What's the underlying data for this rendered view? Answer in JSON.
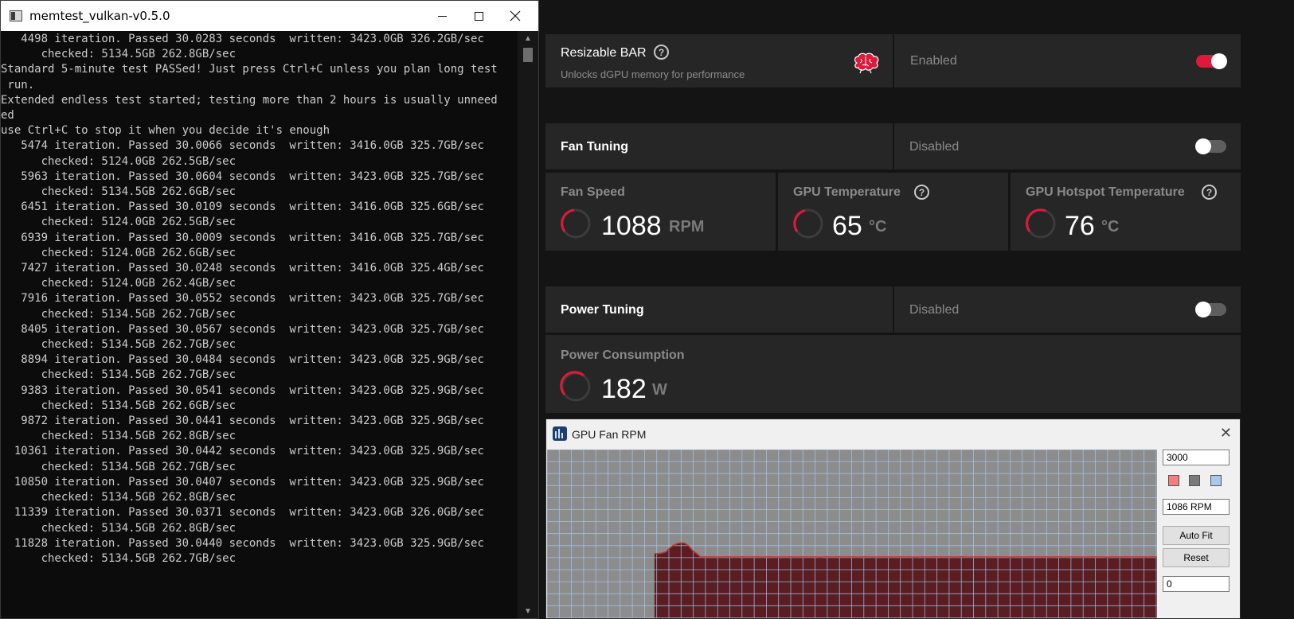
{
  "console": {
    "title": "memtest_vulkan-v0.5.0",
    "lines": [
      "   4498 iteration. Passed 30.0283 seconds  written: 3423.0GB 326.2GB/sec",
      "      checked: 5134.5GB 262.8GB/sec",
      "Standard 5-minute test PASSed! Just press Ctrl+C unless you plan long test",
      " run.",
      "Extended endless test started; testing more than 2 hours is usually unneed",
      "ed",
      "use Ctrl+C to stop it when you decide it's enough",
      "   5474 iteration. Passed 30.0066 seconds  written: 3416.0GB 325.7GB/sec",
      "      checked: 5124.0GB 262.5GB/sec",
      "   5963 iteration. Passed 30.0604 seconds  written: 3423.0GB 325.7GB/sec",
      "      checked: 5134.5GB 262.6GB/sec",
      "   6451 iteration. Passed 30.0109 seconds  written: 3416.0GB 325.6GB/sec",
      "      checked: 5124.0GB 262.5GB/sec",
      "   6939 iteration. Passed 30.0009 seconds  written: 3416.0GB 325.7GB/sec",
      "      checked: 5124.0GB 262.6GB/sec",
      "   7427 iteration. Passed 30.0248 seconds  written: 3416.0GB 325.4GB/sec",
      "      checked: 5124.0GB 262.4GB/sec",
      "   7916 iteration. Passed 30.0552 seconds  written: 3423.0GB 325.7GB/sec",
      "      checked: 5134.5GB 262.7GB/sec",
      "   8405 iteration. Passed 30.0567 seconds  written: 3423.0GB 325.7GB/sec",
      "      checked: 5134.5GB 262.7GB/sec",
      "   8894 iteration. Passed 30.0484 seconds  written: 3423.0GB 325.9GB/sec",
      "      checked: 5134.5GB 262.7GB/sec",
      "   9383 iteration. Passed 30.0541 seconds  written: 3423.0GB 325.9GB/sec",
      "      checked: 5134.5GB 262.6GB/sec",
      "   9872 iteration. Passed 30.0441 seconds  written: 3423.0GB 325.9GB/sec",
      "      checked: 5134.5GB 262.8GB/sec",
      "  10361 iteration. Passed 30.0442 seconds  written: 3423.0GB 325.9GB/sec",
      "      checked: 5134.5GB 262.7GB/sec",
      "  10850 iteration. Passed 30.0407 seconds  written: 3423.0GB 325.9GB/sec",
      "      checked: 5134.5GB 262.8GB/sec",
      "  11339 iteration. Passed 30.0371 seconds  written: 3423.0GB 326.0GB/sec",
      "      checked: 5134.5GB 262.8GB/sec",
      "  11828 iteration. Passed 30.0440 seconds  written: 3423.0GB 325.9GB/sec",
      "      checked: 5134.5GB 262.7GB/sec"
    ]
  },
  "amd": {
    "resizable_bar": {
      "title": "Resizable BAR",
      "subtitle": "Unlocks dGPU memory for performance",
      "state": "Enabled",
      "enabled": true,
      "help_glyph": "?",
      "icon": "brain-icon"
    },
    "fan_tuning": {
      "title": "Fan Tuning",
      "state": "Disabled",
      "enabled": false,
      "metrics": [
        {
          "label": "Fan Speed",
          "value": "1088",
          "unit": "RPM",
          "help": false
        },
        {
          "label": "GPU Temperature",
          "value": "65",
          "unit": "°C",
          "help": true
        },
        {
          "label": "GPU Hotspot Temperature",
          "value": "76",
          "unit": "°C",
          "help": true
        }
      ]
    },
    "power_tuning": {
      "title": "Power Tuning",
      "state": "Disabled",
      "enabled": false,
      "metric": {
        "label": "Power Consumption",
        "value": "182",
        "unit": "W"
      }
    },
    "accent": "#e0193a"
  },
  "graph": {
    "title": "GPU Fan RPM",
    "max_value": "3000",
    "current_value": "1086 RPM",
    "min_value": "0",
    "auto_fit_label": "Auto Fit",
    "reset_label": "Reset",
    "close_glyph": "✕",
    "swatch_colors": [
      "#f08080",
      "#7a7a7a",
      "#a9c8f0"
    ],
    "series_color": "#5a1e22",
    "line_color": "#c0392b",
    "grid_color": "#a9c8f0",
    "bg_color": "#8c8c8c",
    "chart_data": {
      "type": "area",
      "ylim": [
        0,
        3000
      ],
      "values": [
        0,
        0,
        0,
        0,
        0,
        0,
        0,
        0,
        0,
        0,
        0,
        0,
        0,
        0,
        0,
        0,
        0,
        0,
        0,
        0,
        0,
        0,
        0,
        0,
        0,
        0,
        0,
        0,
        1150,
        1150,
        1160,
        1180,
        1250,
        1300,
        1330,
        1340,
        1330,
        1280,
        1200,
        1150,
        1090,
        1090,
        1090,
        1092,
        1090,
        1088,
        1090,
        1091,
        1090,
        1088,
        1090,
        1092,
        1090,
        1089,
        1090,
        1091,
        1088,
        1090,
        1092,
        1090,
        1088,
        1090,
        1089,
        1091,
        1090,
        1088,
        1090,
        1092,
        1090,
        1089,
        1090,
        1087,
        1090,
        1091,
        1088,
        1090,
        1092,
        1090,
        1089,
        1090,
        1091,
        1088,
        1090,
        1092,
        1090,
        1088,
        1090,
        1089,
        1091,
        1090,
        1088,
        1090,
        1092,
        1090,
        1089,
        1090,
        1087,
        1090,
        1091,
        1088,
        1090,
        1092,
        1090,
        1089,
        1090,
        1091,
        1088,
        1090,
        1092,
        1090,
        1088,
        1090,
        1089,
        1091,
        1090,
        1088,
        1090,
        1092,
        1090,
        1089,
        1090,
        1087,
        1090,
        1091,
        1088,
        1090,
        1092,
        1090,
        1089,
        1090,
        1091,
        1088,
        1090,
        1092,
        1090,
        1088,
        1090,
        1089,
        1091,
        1090,
        1088,
        1090,
        1092,
        1090,
        1089,
        1090,
        1087,
        1090,
        1091,
        1088,
        1090,
        1092,
        1090,
        1089,
        1090,
        1091,
        1088,
        1090,
        1092,
        1086
      ]
    }
  }
}
